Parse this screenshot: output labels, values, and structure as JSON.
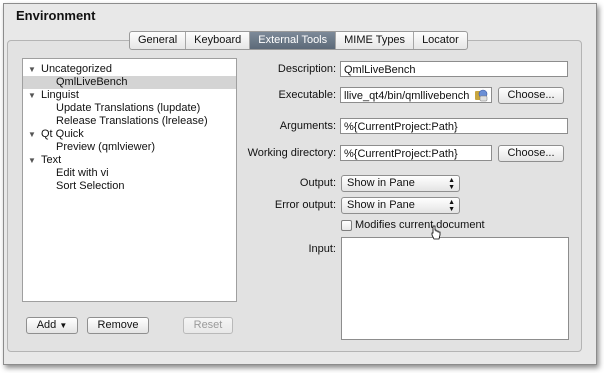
{
  "window": {
    "title": "Environment"
  },
  "tabs": [
    {
      "label": "General",
      "active": false
    },
    {
      "label": "Keyboard",
      "active": false
    },
    {
      "label": "External Tools",
      "active": true
    },
    {
      "label": "MIME Types",
      "active": false
    },
    {
      "label": "Locator",
      "active": false
    }
  ],
  "tree": [
    {
      "kind": "category",
      "label": "Uncategorized",
      "expanded": true
    },
    {
      "kind": "tool",
      "label": "QmlLiveBench",
      "selected": true
    },
    {
      "kind": "category",
      "label": "Linguist",
      "expanded": true
    },
    {
      "kind": "tool",
      "label": "Update Translations (lupdate)"
    },
    {
      "kind": "tool",
      "label": "Release Translations (lrelease)"
    },
    {
      "kind": "category",
      "label": "Qt Quick",
      "expanded": true
    },
    {
      "kind": "tool",
      "label": "Preview (qmlviewer)"
    },
    {
      "kind": "category",
      "label": "Text",
      "expanded": true
    },
    {
      "kind": "tool",
      "label": "Edit with vi"
    },
    {
      "kind": "tool",
      "label": "Sort Selection"
    }
  ],
  "buttons": {
    "add": "Add",
    "remove": "Remove",
    "reset": "Reset",
    "browse_executable": "Choose...",
    "browse_working_dir": "Choose..."
  },
  "form": {
    "description_label": "Description:",
    "description_value": "QmlLiveBench",
    "executable_label": "Executable:",
    "executable_value": "llive_qt4/bin/qmllivebench",
    "arguments_label": "Arguments:",
    "arguments_value": "%{CurrentProject:Path}",
    "working_dir_label": "Working directory:",
    "working_dir_value": "%{CurrentProject:Path}",
    "output_label": "Output:",
    "output_value": "Show in Pane",
    "error_output_label": "Error output:",
    "error_output_value": "Show in Pane",
    "modifies_label": "Modifies current document",
    "modifies_checked": false,
    "input_label": "Input:"
  },
  "colors": {
    "selected_tab": "#6a7787",
    "selected_row": "#d4d4d4"
  }
}
